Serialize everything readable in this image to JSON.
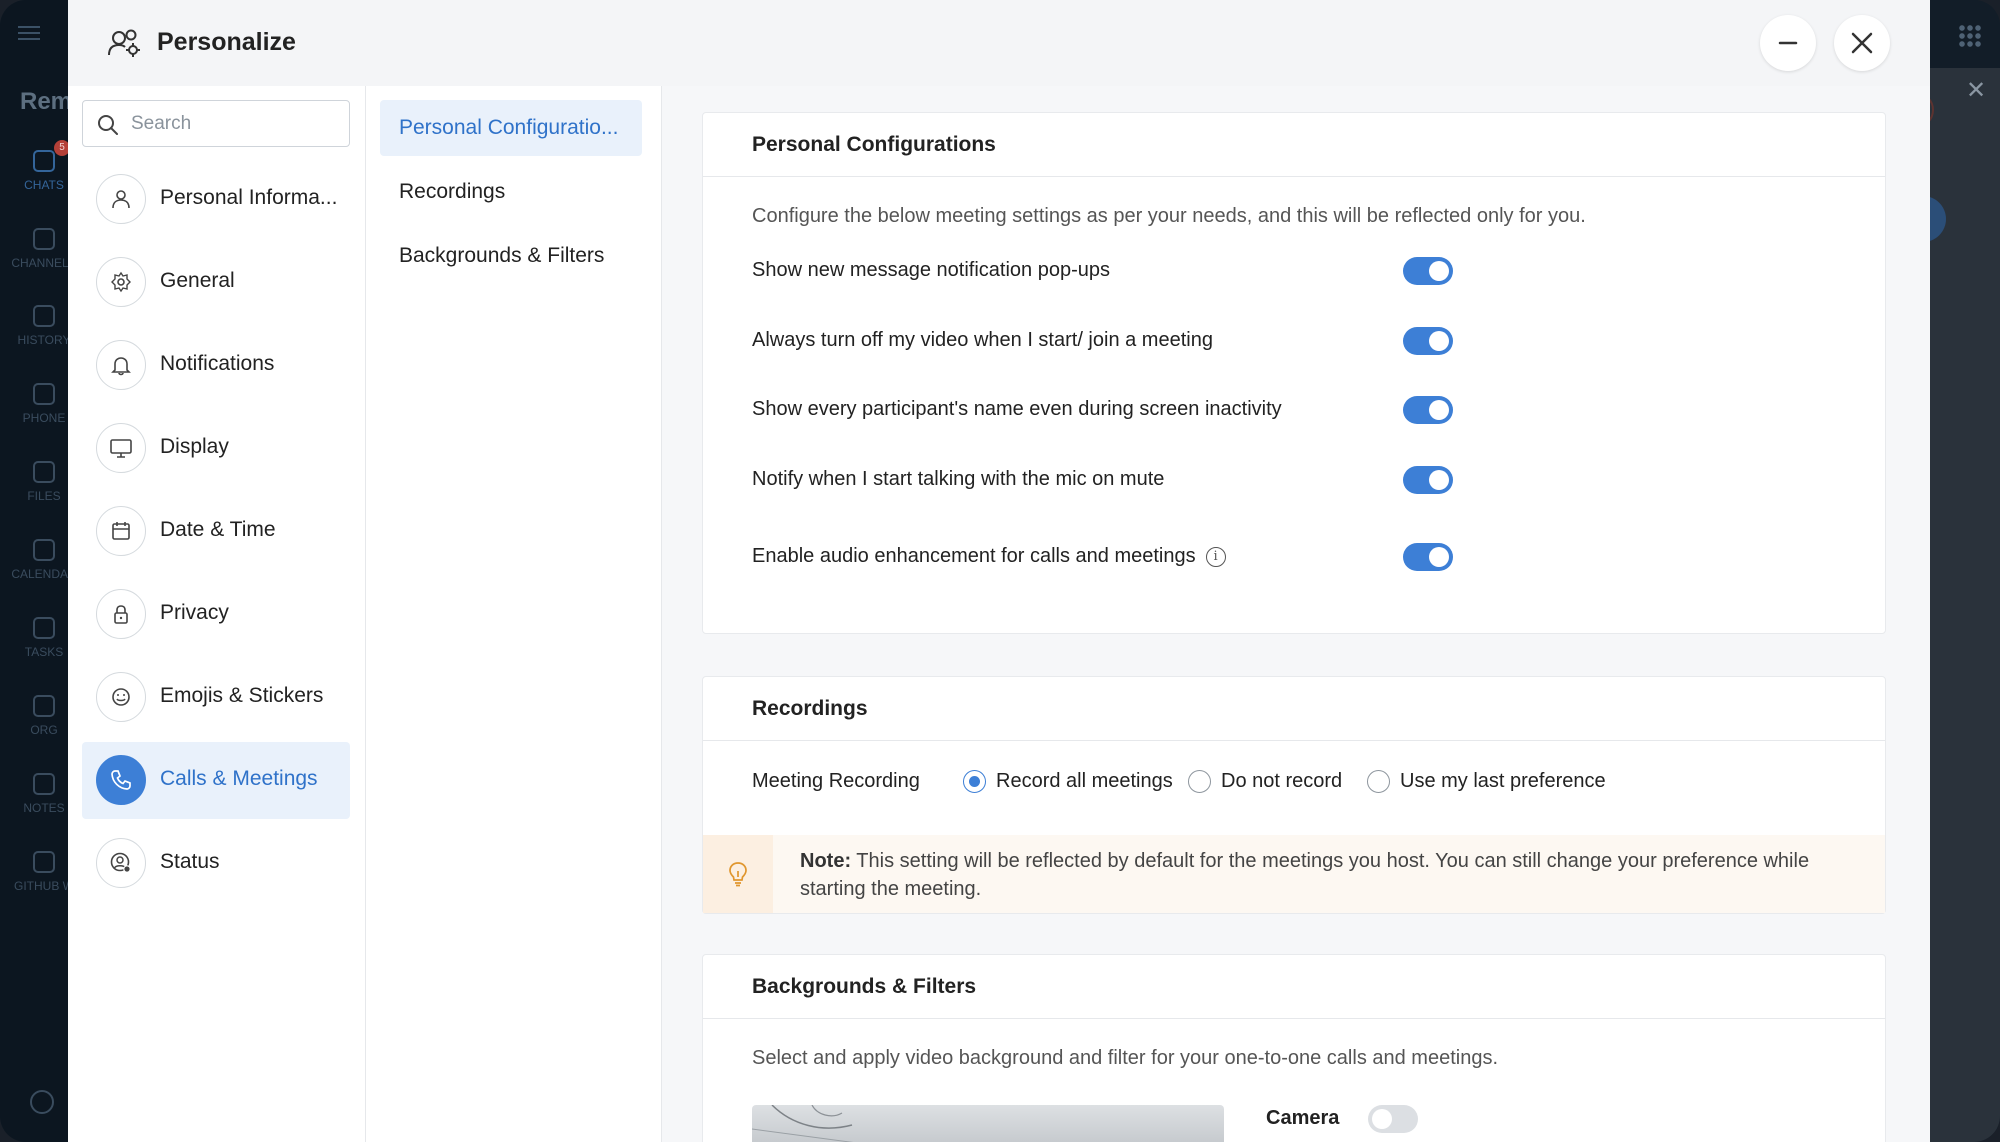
{
  "background_app": {
    "brand": "Rem",
    "badge": "5",
    "rail": [
      "CHATS",
      "CHANNELS",
      "HISTORY",
      "PHONE",
      "FILES",
      "CALENDAR",
      "TASKS",
      "ORG",
      "NOTES",
      "GITHUB W"
    ]
  },
  "modal": {
    "title": "Personalize"
  },
  "search": {
    "placeholder": "Search"
  },
  "sidebar": {
    "items": [
      {
        "label": "Personal Informa...",
        "icon": "person-icon"
      },
      {
        "label": "General",
        "icon": "gear-icon"
      },
      {
        "label": "Notifications",
        "icon": "bell-icon"
      },
      {
        "label": "Display",
        "icon": "monitor-icon"
      },
      {
        "label": "Date & Time",
        "icon": "calendar-icon"
      },
      {
        "label": "Privacy",
        "icon": "lock-icon"
      },
      {
        "label": "Emojis & Stickers",
        "icon": "smiley-icon"
      },
      {
        "label": "Calls & Meetings",
        "icon": "phone-icon",
        "active": true
      },
      {
        "label": "Status",
        "icon": "status-icon"
      }
    ]
  },
  "subnav": {
    "items": [
      {
        "label": "Personal Configuratio...",
        "active": true
      },
      {
        "label": "Recordings"
      },
      {
        "label": "Backgrounds & Filters"
      }
    ]
  },
  "personal_config": {
    "title": "Personal Configurations",
    "description": "Configure the below meeting settings as per your needs, and this will be reflected only for you.",
    "settings": [
      {
        "label": "Show new message notification pop-ups",
        "enabled": true
      },
      {
        "label": "Always turn off my video when I start/ join a meeting",
        "enabled": true
      },
      {
        "label": "Show every participant's name even during screen inactivity",
        "enabled": true
      },
      {
        "label": "Notify when I start talking with the mic on mute",
        "enabled": true
      },
      {
        "label": "Enable audio enhancement for calls and meetings",
        "enabled": true,
        "info_icon": "i"
      }
    ]
  },
  "recordings": {
    "title": "Recordings",
    "label": "Meeting Recording",
    "options": [
      "Record all meetings",
      "Do not record",
      "Use my last preference"
    ],
    "selected": "Record all meetings",
    "note_prefix": "Note:",
    "note_text": " This setting will be reflected by default for the meetings you host. You can still change your preference while starting the meeting."
  },
  "backgrounds": {
    "title": "Backgrounds & Filters",
    "description": "Select and apply video background and filter for your one-to-one calls and meetings.",
    "camera_label": "Camera",
    "camera_enabled": false
  },
  "colors": {
    "accent": "#3d7fd6",
    "active_bg": "#e9f1fb",
    "note_bg": "#fdf8f2"
  }
}
